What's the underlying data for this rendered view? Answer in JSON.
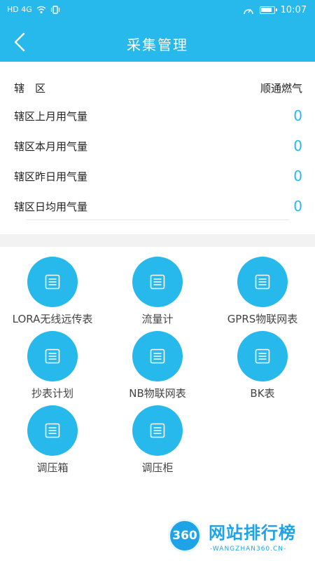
{
  "status_bar": {
    "left_indicators": "HD 4G",
    "time": "10:07"
  },
  "header": {
    "title": "采集管理",
    "back_icon": "chevron-left-icon"
  },
  "summary": {
    "rows": [
      {
        "label": "辖　区",
        "value": "顺通燃气"
      },
      {
        "label": "辖区上月用气量",
        "value": "0"
      },
      {
        "label": "辖区本月用气量",
        "value": "0"
      },
      {
        "label": "辖区昨日用气量",
        "value": "0"
      },
      {
        "label": "辖区日均用气量",
        "value": "0"
      }
    ]
  },
  "grid": {
    "items": [
      {
        "label": "LORA无线远传表",
        "icon": "list-icon"
      },
      {
        "label": "流量计",
        "icon": "list-icon"
      },
      {
        "label": "GPRS物联网表",
        "icon": "list-icon"
      },
      {
        "label": "抄表计划",
        "icon": "list-icon"
      },
      {
        "label": "NB物联网表",
        "icon": "list-icon"
      },
      {
        "label": "BK表",
        "icon": "list-icon"
      },
      {
        "label": "调压箱",
        "icon": "list-icon"
      },
      {
        "label": "调压柜",
        "icon": "list-icon"
      }
    ]
  },
  "watermark": {
    "badge": "360",
    "title": "网站排行榜",
    "subtitle": "-WANGZHAN360.CN-"
  },
  "colors": {
    "primary": "#27b8ec",
    "background": "#ffffff",
    "band": "#f2f2f2"
  }
}
